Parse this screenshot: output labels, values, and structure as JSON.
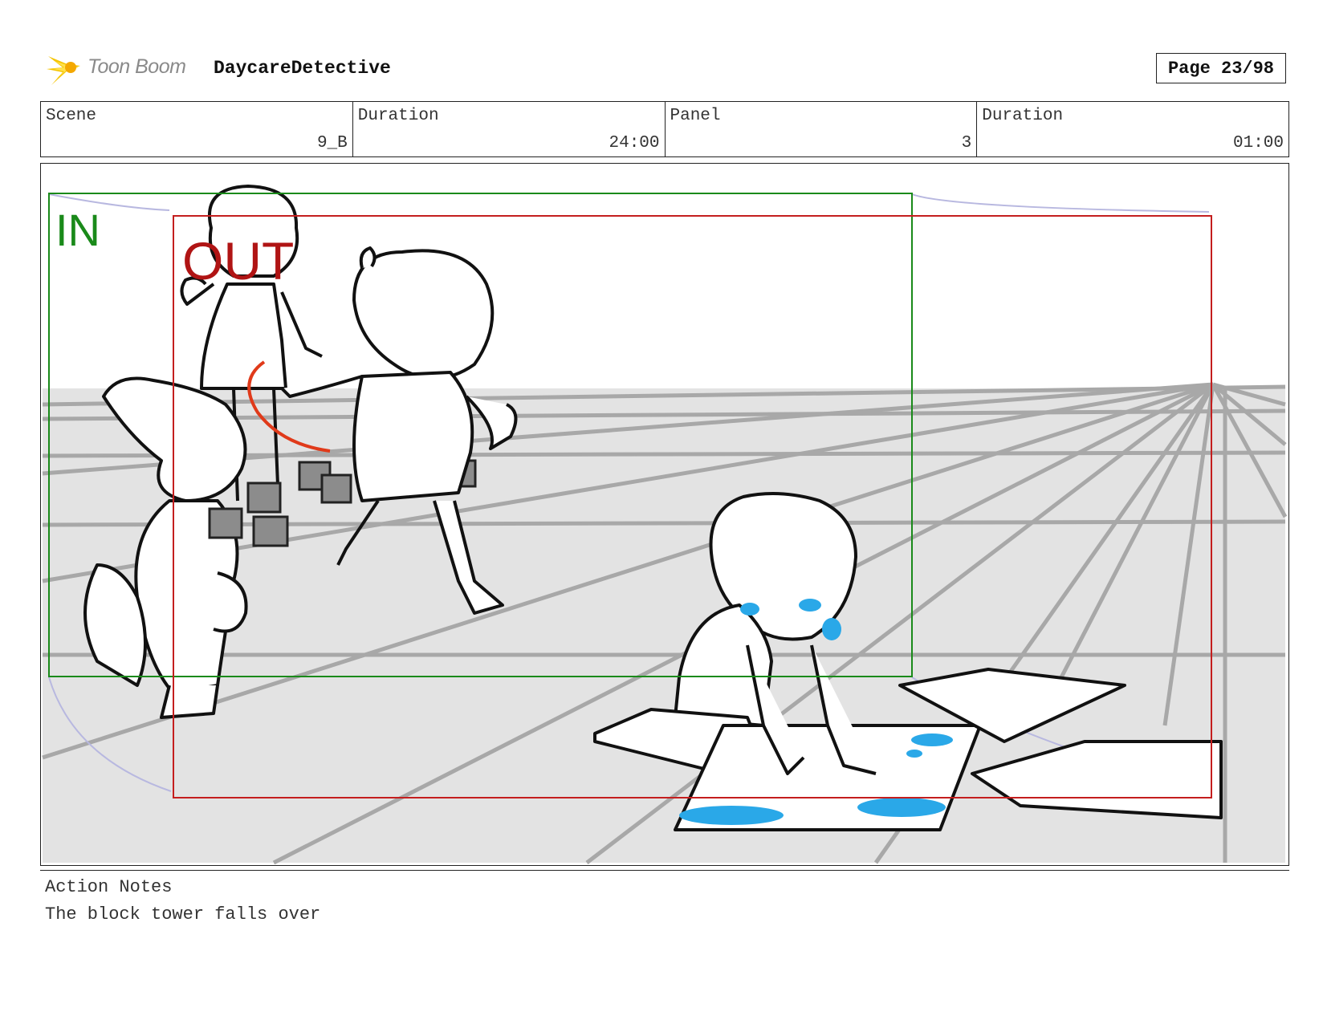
{
  "header": {
    "logo": {
      "icon": "toon-boom-starburst-icon",
      "text": "Toon Boom"
    },
    "project_name": "DaycareDetective",
    "page_label": "Page 23/98"
  },
  "info_table": [
    {
      "label": "Scene",
      "value": "9_B"
    },
    {
      "label": "Duration",
      "value": "24:00"
    },
    {
      "label": "Panel",
      "value": "3"
    },
    {
      "label": "Duration",
      "value": "01:00"
    }
  ],
  "panel": {
    "in_frame_label": "IN",
    "out_frame_label": "OUT",
    "colors": {
      "in_frame": "#1a8a1a",
      "out_frame": "#c41e1e",
      "motion_arrow": "#e03a1a",
      "camera_path": "#b8b8e0",
      "floor": "#e3e3e3",
      "grid": "#a8a8a8",
      "water": "#2aa8e8"
    }
  },
  "notes": {
    "label": "Action Notes",
    "text": "The block tower falls over"
  }
}
